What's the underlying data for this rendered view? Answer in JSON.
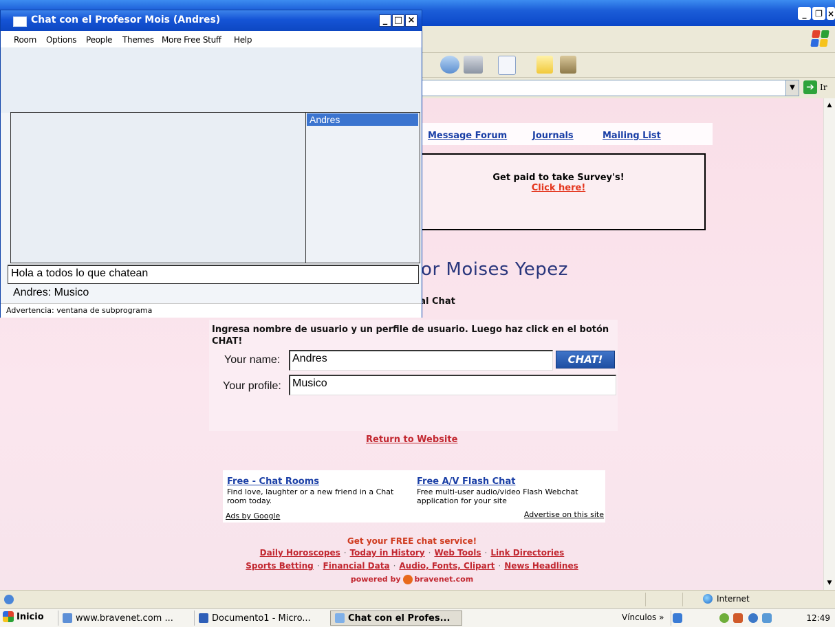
{
  "chat_window": {
    "title": "Chat con el Profesor Mois (Andres)",
    "controls": {
      "minimize": "_",
      "maximize": "□",
      "close": "×"
    },
    "menu": [
      "Room",
      "Options",
      "People",
      "Themes",
      "More Free Stuff",
      "Help"
    ],
    "users": [
      "Andres"
    ],
    "message_input": "Hola a todos lo que chatean",
    "user_line": "Andres: Musico",
    "status": "Advertencia: ventana de subprograma"
  },
  "browser": {
    "controls": {
      "minimize": "_",
      "restore": "❐",
      "close": "×"
    },
    "go_label": "Ir",
    "status_zone": "Internet"
  },
  "page": {
    "nav_links": [
      "Message Forum",
      "Journals",
      "Mailing List"
    ],
    "survey": {
      "text": "Get paid to take Survey's!",
      "link": "Click here!"
    },
    "heading": "sor Moises Yepez",
    "welcome": "s al Chat",
    "instructions": "Ingresa nombre de usuario y un perfile de usuario. Luego haz click en el botón CHAT!",
    "form": {
      "name_label": "Your name:",
      "name_value": "Andres",
      "profile_label": "Your profile:",
      "profile_value": "Musico",
      "chat_button": "CHAT!"
    },
    "return_link": "Return to Website",
    "ads": {
      "ad1_title": "Free - Chat Rooms",
      "ad1_desc": "Find love, laughter or a new friend in a Chat room today.",
      "ad2_title": "Free A/V Flash Chat",
      "ad2_desc": "Free multi-user audio/video Flash Webchat application for your site",
      "by": "Ads by Google",
      "advertise": "Advertise on this site"
    },
    "footer": {
      "promo": "Get your FREE chat service!",
      "row1": [
        "Daily Horoscopes",
        "Today in History",
        "Web Tools",
        "Link Directories"
      ],
      "row2": [
        "Sports Betting",
        "Financial Data",
        "Audio, Fonts, Clipart",
        "News Headlines"
      ],
      "powered_prefix": "powered by",
      "powered_brand": "bravenet.com"
    }
  },
  "taskbar": {
    "start": "Inicio",
    "tasks": [
      "www.bravenet.com ...",
      "Documento1 - Micro...",
      "Chat con el Profes..."
    ],
    "links_label": "Vínculos »",
    "clock": "12:49"
  },
  "colors": {
    "title_blue": "#0a46c8",
    "page_pink": "#fbe6ee",
    "link_blue": "#1a3fa6",
    "link_red": "#c22730",
    "chat_button": "#1f4fa3"
  }
}
